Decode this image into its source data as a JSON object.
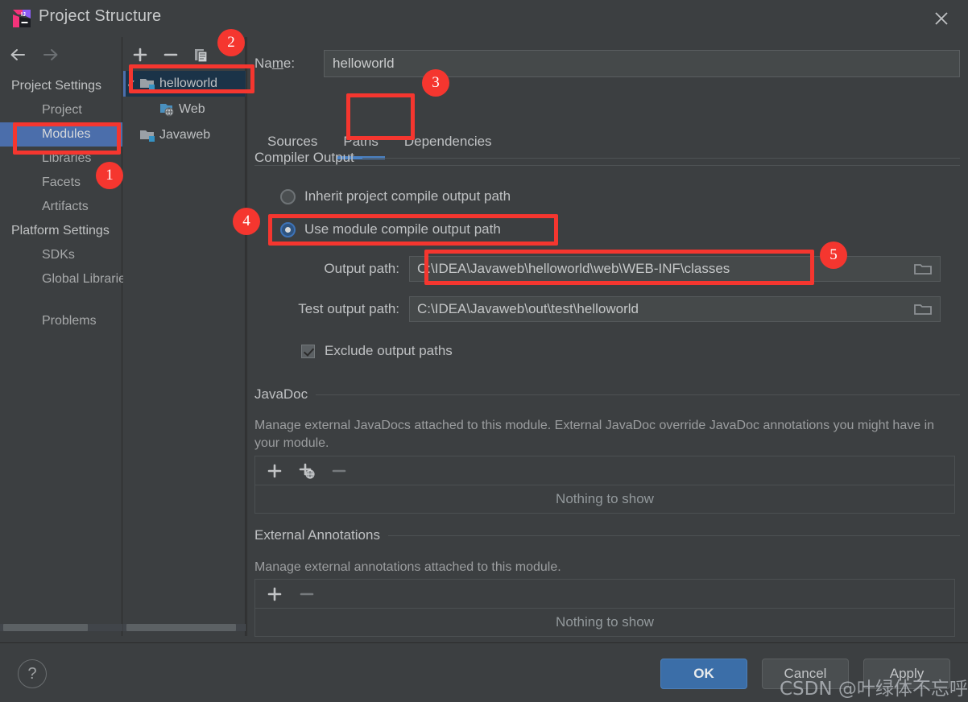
{
  "window": {
    "title": "Project Structure",
    "logo_icon": "intellij-idea-logo",
    "close_icon": "close-icon"
  },
  "navigation": {
    "back_icon": "arrow-left-icon",
    "forward_icon": "arrow-right-icon"
  },
  "sidebar": {
    "groups": [
      {
        "header": "Project Settings",
        "items": [
          {
            "label": "Project",
            "selected": false
          },
          {
            "label": "Modules",
            "selected": true
          },
          {
            "label": "Libraries",
            "selected": false
          },
          {
            "label": "Facets",
            "selected": false
          },
          {
            "label": "Artifacts",
            "selected": false
          }
        ]
      },
      {
        "header": "Platform Settings",
        "items": [
          {
            "label": "SDKs",
            "selected": false
          },
          {
            "label": "Global Libraries",
            "selected": false
          }
        ]
      }
    ],
    "footer_item": "Problems"
  },
  "modules_panel": {
    "toolbar": {
      "add_icon": "plus-icon",
      "remove_icon": "minus-icon",
      "copy_icon": "copy-icon"
    },
    "tree": [
      {
        "label": "helloworld",
        "icon": "module-folder-icon",
        "checked": true,
        "selected": true,
        "depth": 0
      },
      {
        "label": "Web",
        "icon": "web-facet-icon",
        "checked": false,
        "selected": false,
        "depth": 1
      },
      {
        "label": "Javaweb",
        "icon": "module-folder-icon",
        "checked": false,
        "selected": false,
        "depth": 0
      }
    ]
  },
  "main": {
    "name_label": "Name:",
    "name_value": "helloworld",
    "tabs": [
      {
        "label": "Sources",
        "active": false
      },
      {
        "label": "Paths",
        "active": true
      },
      {
        "label": "Dependencies",
        "active": false
      }
    ],
    "compiler_output": {
      "section_title": "Compiler Output",
      "options": [
        {
          "label": "Inherit project compile output path",
          "checked": false
        },
        {
          "label": "Use module compile output path",
          "checked": true
        }
      ],
      "output_path": {
        "label": "Output path:",
        "value": "C:\\IDEA\\Javaweb\\helloworld\\web\\WEB-INF\\classes",
        "browse_icon": "folder-icon"
      },
      "test_output_path": {
        "label": "Test output path:",
        "value": "C:\\IDEA\\Javaweb\\out\\test\\helloworld",
        "browse_icon": "folder-icon"
      },
      "exclude_checkbox": {
        "label": "Exclude output paths",
        "checked": true
      }
    },
    "javadoc": {
      "section_title": "JavaDoc",
      "description": "Manage external JavaDocs attached to this module. External JavaDoc override JavaDoc annotations you might have in your module.",
      "toolbar": {
        "add_icon": "plus-icon",
        "add_url_icon": "plus-globe-icon",
        "remove_icon": "minus-icon"
      },
      "empty_text": "Nothing to show"
    },
    "external_annotations": {
      "section_title": "External Annotations",
      "description": "Manage external annotations attached to this module.",
      "toolbar": {
        "add_icon": "plus-icon",
        "remove_icon": "minus-icon"
      },
      "empty_text": "Nothing to show"
    }
  },
  "footer": {
    "help_label": "?",
    "ok_label": "OK",
    "cancel_label": "Cancel",
    "apply_label": "Apply"
  },
  "watermark": {
    "text": "CSDN @叶绿体不忘呼吸"
  },
  "annotations": {
    "badges": [
      {
        "number": "1"
      },
      {
        "number": "2"
      },
      {
        "number": "3"
      },
      {
        "number": "4"
      },
      {
        "number": "5"
      }
    ],
    "accent_color": "#F5362F"
  }
}
